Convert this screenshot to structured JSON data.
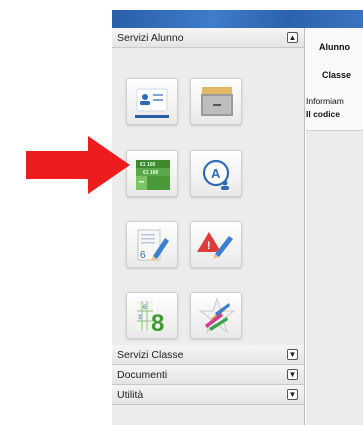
{
  "sidebar": {
    "sections": [
      {
        "label": "Servizi Alunno",
        "toggle": "▲"
      },
      {
        "label": "Servizi Classe",
        "toggle": "▼"
      },
      {
        "label": "Documenti",
        "toggle": "▼"
      },
      {
        "label": "Utilità",
        "toggle": "▼"
      }
    ],
    "tiles": [
      {
        "icon": "student-card-icon"
      },
      {
        "icon": "drawer-archive-icon"
      },
      {
        "icon": "student-tax-grid-icon",
        "highlighted": true
      },
      {
        "icon": "absence-user-icon",
        "letter": "A"
      },
      {
        "icon": "grades-notebook-pencil-icon",
        "digit": "6"
      },
      {
        "icon": "notes-warning-pencil-icon",
        "mark": "!"
      },
      {
        "icon": "score-grid-icon",
        "small_digits": [
          "6",
          "3"
        ],
        "big_digit": "8"
      },
      {
        "icon": "colored-star-icon"
      }
    ],
    "tile_grid_text": {
      "row1": "€1 100",
      "row2": "€1 100"
    }
  },
  "main": {
    "lines": [
      "Alunno",
      "Classe",
      "Informiam",
      "Il codice"
    ]
  },
  "annotation": {
    "icon": "red-arrow-icon",
    "color": "#ee1c1c"
  },
  "colors": {
    "topbar": "#3367b4",
    "sidebar_bg": "#ececec",
    "accent_green": "#4f9a3a",
    "accent_blue": "#2f6ab4"
  }
}
